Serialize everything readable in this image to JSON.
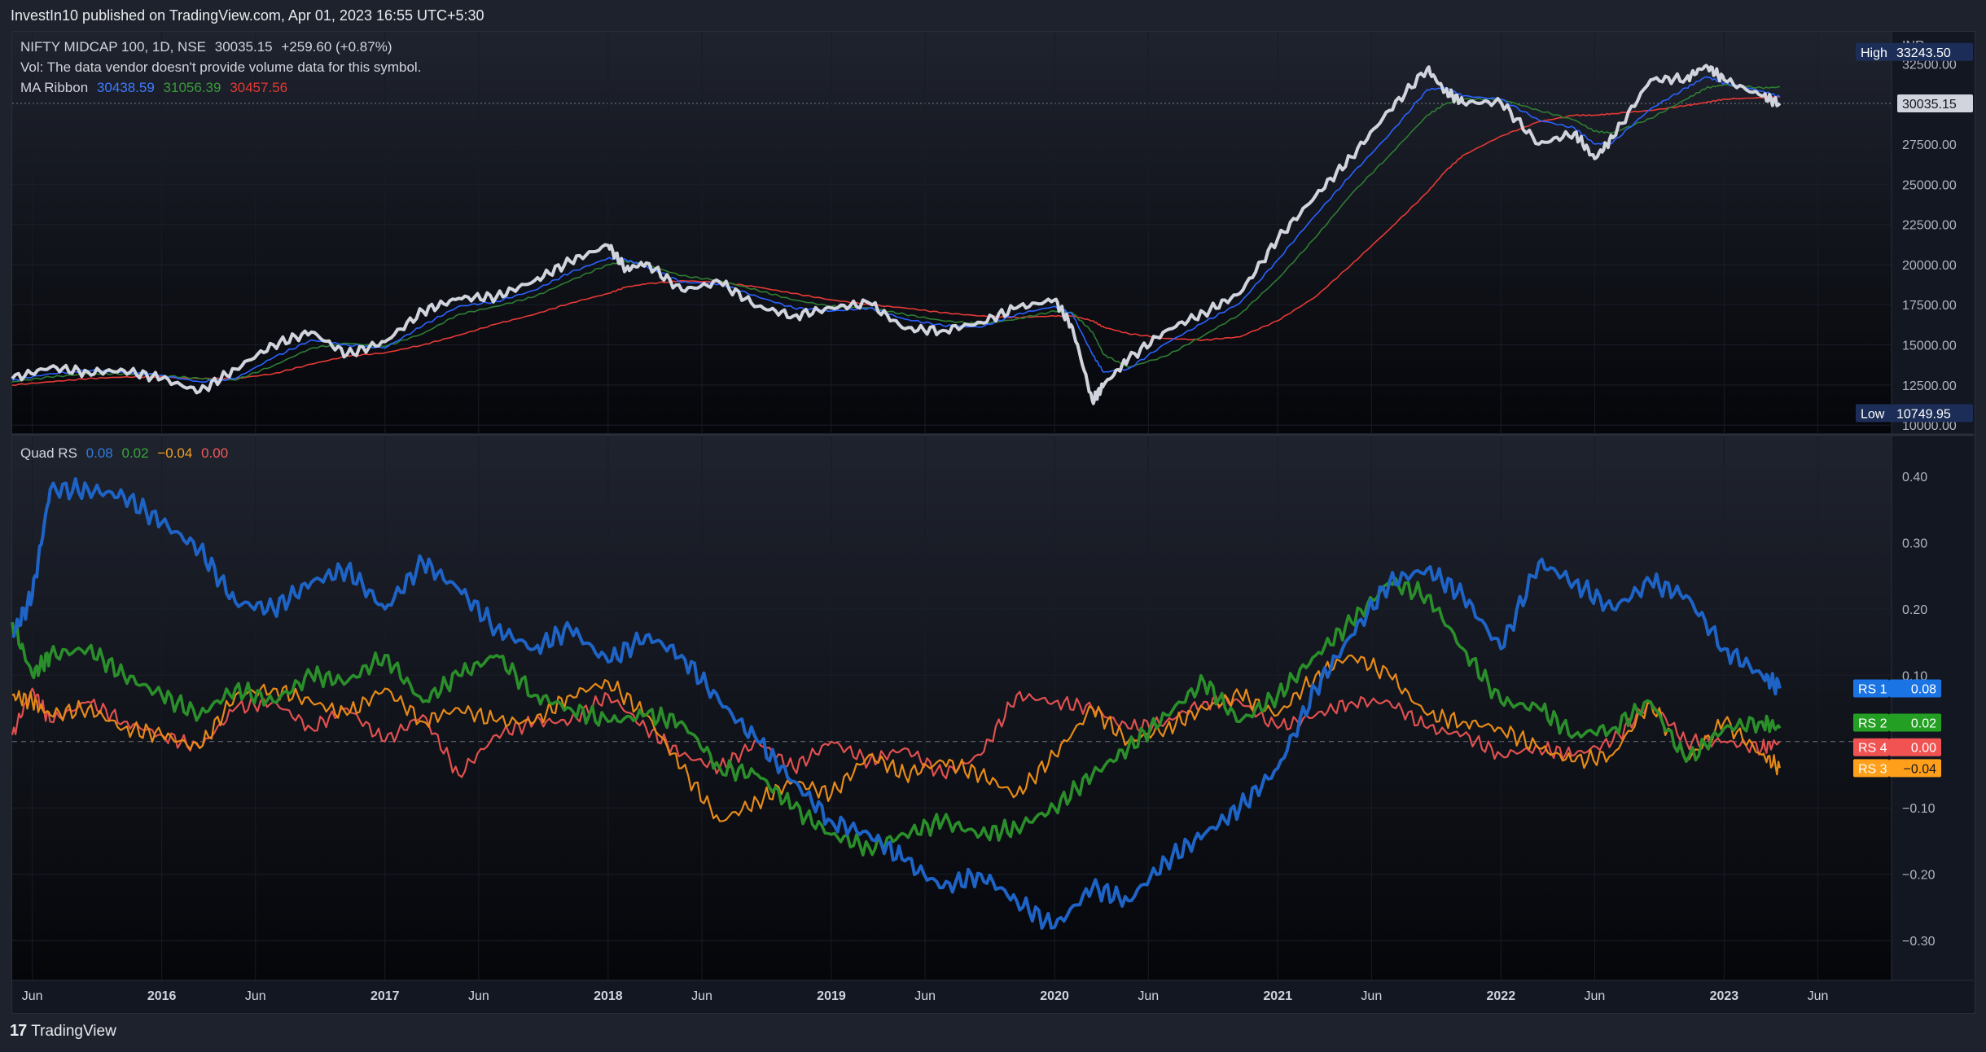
{
  "header": {
    "published_by": "InvestIn10 published on TradingView.com, Apr 01, 2023 16:55 UTC+5:30"
  },
  "footer": {
    "brand": "TradingView",
    "logo_glyph": "17"
  },
  "colors": {
    "price": "#d1d4dc",
    "ma1": "#2962ff",
    "ma2": "#2e7d32",
    "ma3": "#e53935",
    "rs1": "#1e63c6",
    "rs2": "#2a8f2a",
    "rs3": "#e68a17",
    "rs4": "#e0504f"
  },
  "chart_data": [
    {
      "type": "line",
      "title": "NIFTY MIDCAP 100, 1D, NSE",
      "legend": {
        "symbol": "NIFTY MIDCAP 100, 1D, NSE",
        "last": "30035.15",
        "change": "+259.60 (+0.87%)",
        "vol_note": "Vol: The data vendor doesn't provide volume data for this symbol.",
        "ma_label": "MA Ribbon",
        "ma_values": [
          "30438.59",
          "31056.39",
          "30457.56"
        ]
      },
      "currency": "INR",
      "ylim": [
        9500,
        34500
      ],
      "y_ticks": [
        "32500.00",
        "30000.00",
        "27500.00",
        "25000.00",
        "22500.00",
        "20000.00",
        "17500.00",
        "15000.00",
        "12500.00",
        "10000.00"
      ],
      "high_label": "High",
      "high_value": "33243.50",
      "low_label": "Low",
      "low_value": "10749.95",
      "last_price_tag": "30035.15",
      "x": [
        2015.33,
        2015.5,
        2015.67,
        2015.83,
        2016.0,
        2016.17,
        2016.33,
        2016.5,
        2016.67,
        2016.83,
        2017.0,
        2017.17,
        2017.33,
        2017.5,
        2017.67,
        2017.83,
        2018.0,
        2018.08,
        2018.17,
        2018.33,
        2018.5,
        2018.67,
        2018.83,
        2019.0,
        2019.17,
        2019.33,
        2019.5,
        2019.67,
        2019.83,
        2020.0,
        2020.08,
        2020.17,
        2020.22,
        2020.33,
        2020.5,
        2020.67,
        2020.83,
        2021.0,
        2021.17,
        2021.33,
        2021.5,
        2021.67,
        2021.75,
        2021.83,
        2022.0,
        2022.17,
        2022.33,
        2022.42,
        2022.5,
        2022.67,
        2022.83,
        2022.92,
        2023.0,
        2023.17,
        2023.25
      ],
      "series": [
        {
          "name": "NIFTY MIDCAP 100",
          "values": [
            12900,
            13600,
            13300,
            13400,
            12900,
            12100,
            13500,
            15000,
            15800,
            14400,
            15200,
            17100,
            17900,
            18000,
            19000,
            20200,
            21200,
            19700,
            20100,
            18400,
            18900,
            17400,
            16800,
            17300,
            17600,
            16000,
            15900,
            16400,
            17300,
            17800,
            16100,
            11500,
            12500,
            14100,
            15900,
            17000,
            18200,
            21600,
            24300,
            26700,
            29600,
            32200,
            30800,
            30100,
            30100,
            27500,
            28200,
            26600,
            27900,
            31500,
            31600,
            32400,
            31500,
            30500,
            30035
          ]
        },
        {
          "name": "MA 1",
          "values": [
            12800,
            13200,
            13400,
            13300,
            13100,
            12700,
            12900,
            14200,
            15300,
            15000,
            14800,
            16200,
            17400,
            17700,
            18400,
            19500,
            20400,
            20300,
            19900,
            18900,
            18800,
            18000,
            17300,
            17100,
            17300,
            16600,
            16200,
            16100,
            16900,
            17400,
            16900,
            14400,
            13300,
            13500,
            15100,
            16400,
            17600,
            20300,
            23100,
            25600,
            28100,
            30900,
            31000,
            30500,
            30300,
            29000,
            28500,
            27500,
            27600,
            29700,
            31000,
            31700,
            31300,
            30800,
            30439
          ]
        },
        {
          "name": "MA 2",
          "values": [
            12700,
            13000,
            13200,
            13200,
            13100,
            12900,
            12800,
            13700,
            14800,
            15100,
            14900,
            15700,
            16900,
            17400,
            18000,
            19000,
            20000,
            20200,
            20000,
            19300,
            19000,
            18400,
            17800,
            17400,
            17300,
            16900,
            16500,
            16300,
            16600,
            17100,
            17000,
            15800,
            14400,
            13600,
            14300,
            15600,
            16900,
            19100,
            21700,
            24400,
            26800,
            29300,
            30000,
            30300,
            30300,
            29600,
            29000,
            28300,
            28200,
            29100,
            30300,
            31000,
            31200,
            31000,
            31056
          ]
        },
        {
          "name": "MA 3",
          "values": [
            12500,
            12700,
            12900,
            13000,
            13000,
            12900,
            12900,
            13200,
            13800,
            14300,
            14500,
            15000,
            15600,
            16300,
            16900,
            17600,
            18200,
            18600,
            18800,
            19000,
            18900,
            18600,
            18200,
            17800,
            17500,
            17300,
            17000,
            16800,
            16700,
            16800,
            16800,
            16500,
            16100,
            15700,
            15400,
            15300,
            15500,
            16500,
            18000,
            20000,
            22200,
            24500,
            25800,
            26800,
            28000,
            28900,
            29300,
            29300,
            29400,
            29600,
            29900,
            30100,
            30300,
            30400,
            30458
          ]
        }
      ]
    },
    {
      "type": "line",
      "title": "Quad RS",
      "legend_values": [
        "0.08",
        "0.02",
        "−0.04",
        "0.00"
      ],
      "ylim": [
        -0.36,
        0.46
      ],
      "y_ticks": [
        "0.40",
        "0.30",
        "0.20",
        "0.10",
        "−0.10",
        "−0.20",
        "−0.30"
      ],
      "zero_line": 0,
      "x": [
        2015.33,
        2015.42,
        2015.5,
        2015.67,
        2015.83,
        2016.0,
        2016.17,
        2016.33,
        2016.5,
        2016.67,
        2016.83,
        2017.0,
        2017.17,
        2017.33,
        2017.5,
        2017.67,
        2017.83,
        2018.0,
        2018.17,
        2018.33,
        2018.5,
        2018.67,
        2018.83,
        2019.0,
        2019.17,
        2019.33,
        2019.5,
        2019.67,
        2019.83,
        2020.0,
        2020.17,
        2020.33,
        2020.5,
        2020.67,
        2020.83,
        2021.0,
        2021.17,
        2021.33,
        2021.5,
        2021.67,
        2021.83,
        2022.0,
        2022.17,
        2022.33,
        2022.5,
        2022.67,
        2022.83,
        2023.0,
        2023.17,
        2023.25
      ],
      "series": [
        {
          "name": "RS 1",
          "values": [
            0.16,
            0.22,
            0.38,
            0.38,
            0.37,
            0.33,
            0.29,
            0.21,
            0.2,
            0.24,
            0.26,
            0.2,
            0.27,
            0.23,
            0.17,
            0.14,
            0.17,
            0.12,
            0.16,
            0.13,
            0.06,
            0.0,
            -0.06,
            -0.12,
            -0.14,
            -0.18,
            -0.22,
            -0.2,
            -0.24,
            -0.28,
            -0.22,
            -0.24,
            -0.18,
            -0.14,
            -0.1,
            -0.04,
            0.08,
            0.16,
            0.24,
            0.26,
            0.22,
            0.14,
            0.27,
            0.24,
            0.2,
            0.24,
            0.22,
            0.14,
            0.1,
            0.08
          ]
        },
        {
          "name": "RS 2",
          "values": [
            0.18,
            0.1,
            0.13,
            0.14,
            0.1,
            0.07,
            0.04,
            0.08,
            0.06,
            0.1,
            0.09,
            0.13,
            0.06,
            0.1,
            0.13,
            0.07,
            0.05,
            0.03,
            0.04,
            0.03,
            -0.04,
            -0.05,
            -0.1,
            -0.14,
            -0.16,
            -0.14,
            -0.12,
            -0.14,
            -0.13,
            -0.1,
            -0.05,
            -0.01,
            0.04,
            0.09,
            0.03,
            0.07,
            0.13,
            0.18,
            0.24,
            0.22,
            0.14,
            0.06,
            0.05,
            0.01,
            0.02,
            0.06,
            -0.03,
            0.02,
            0.03,
            0.02
          ]
        },
        {
          "name": "RS 3",
          "values": [
            0.07,
            0.06,
            0.04,
            0.05,
            0.02,
            0.01,
            -0.01,
            0.07,
            0.08,
            0.06,
            0.04,
            0.08,
            0.03,
            0.05,
            0.03,
            0.03,
            0.07,
            0.09,
            0.04,
            -0.04,
            -0.12,
            -0.09,
            -0.06,
            -0.08,
            -0.02,
            -0.05,
            -0.03,
            -0.05,
            -0.08,
            -0.02,
            0.05,
            0.0,
            0.02,
            0.05,
            0.07,
            0.04,
            0.1,
            0.13,
            0.1,
            0.04,
            0.03,
            0.02,
            -0.01,
            -0.03,
            -0.02,
            0.06,
            -0.03,
            0.03,
            -0.02,
            -0.04
          ]
        },
        {
          "name": "RS 4",
          "values": [
            0.01,
            0.08,
            0.03,
            0.06,
            0.03,
            0.01,
            -0.01,
            0.05,
            0.06,
            0.02,
            0.05,
            0.0,
            0.04,
            -0.05,
            0.01,
            0.03,
            0.03,
            0.07,
            0.02,
            -0.02,
            -0.04,
            0.0,
            -0.04,
            0.0,
            -0.03,
            -0.01,
            -0.05,
            -0.02,
            0.07,
            0.06,
            0.05,
            0.02,
            0.03,
            0.06,
            0.06,
            0.02,
            0.04,
            0.06,
            0.06,
            0.02,
            0.01,
            -0.02,
            -0.01,
            -0.02,
            0.0,
            0.06,
            0.0,
            0.0,
            -0.01,
            0.0
          ]
        }
      ],
      "series_tags": [
        {
          "label": "RS 1",
          "value": "0.08"
        },
        {
          "label": "RS 2",
          "value": "0.02"
        },
        {
          "label": "RS 4",
          "value": "0.00"
        },
        {
          "label": "RS 3",
          "value": "−0.04"
        }
      ]
    }
  ],
  "time_axis": {
    "labels": [
      "Jun",
      "2016",
      "Jun",
      "2017",
      "Jun",
      "2018",
      "Jun",
      "2019",
      "Jun",
      "2020",
      "Jun",
      "2021",
      "Jun",
      "2022",
      "Jun",
      "2023",
      "Jun"
    ],
    "positions": [
      2015.42,
      2016.0,
      2016.42,
      2017.0,
      2017.42,
      2018.0,
      2018.42,
      2019.0,
      2019.42,
      2020.0,
      2020.42,
      2021.0,
      2021.42,
      2022.0,
      2022.42,
      2023.0,
      2023.42
    ]
  }
}
